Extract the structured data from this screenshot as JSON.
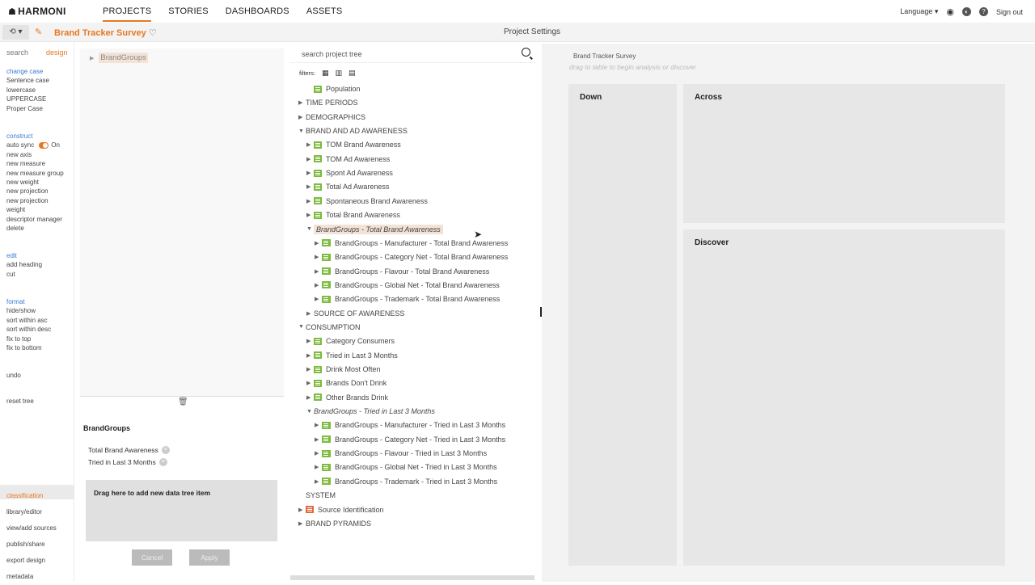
{
  "app": {
    "logo": "HARMONI"
  },
  "nav": {
    "items": [
      "PROJECTS",
      "STORIES",
      "DASHBOARDS",
      "ASSETS"
    ],
    "active": "PROJECTS"
  },
  "topright": {
    "language": "Language",
    "signout": "Sign out"
  },
  "subbar": {
    "project_title": "Brand Tracker Survey",
    "settings": "Project Settings"
  },
  "sidebar": {
    "tabs": [
      "search",
      "design"
    ],
    "active_tab": "design",
    "change_case": {
      "heading": "change case",
      "items": [
        "Sentence case",
        "lowercase",
        "UPPERCASE",
        "Proper Case"
      ]
    },
    "construct": {
      "heading": "construct",
      "auto_sync": "auto sync",
      "auto_sync_state": "On",
      "items": [
        "new axis",
        "new measure",
        "new measure group",
        "new weight",
        "new projection",
        "new projection",
        "weight",
        "descriptor manager",
        "delete"
      ]
    },
    "edit": {
      "heading": "edit",
      "items": [
        "add heading",
        "cut"
      ]
    },
    "format": {
      "heading": "format",
      "items": [
        "hide/show",
        "sort within asc",
        "sort within desc",
        "fix to top",
        "fix to bottom"
      ]
    },
    "undo": "undo",
    "reset": "reset tree",
    "bottom": [
      "classification",
      "library/editor",
      "view/add sources",
      "publish/share",
      "export design",
      "metadata"
    ],
    "bottom_active": "classification"
  },
  "classification": {
    "root_label": "BrandGroups",
    "panel_title": "BrandGroups",
    "items": [
      "Total Brand Awareness",
      "Tried in Last 3 Months"
    ],
    "dropzone": "Drag here to add new data tree item",
    "cancel": "Cancel",
    "apply": "Apply"
  },
  "project_tree": {
    "search_placeholder": "search project tree",
    "filters_label": "filters:",
    "rows": [
      {
        "label": "Population",
        "type": "list",
        "indent": 1,
        "caret": ""
      },
      {
        "label": "TIME PERIODS",
        "type": "folder",
        "indent": 0,
        "caret": "▶"
      },
      {
        "label": "DEMOGRAPHICS",
        "type": "folder",
        "indent": 0,
        "caret": "▶"
      },
      {
        "label": "BRAND AND AD AWARENESS",
        "type": "folder",
        "indent": 0,
        "caret": "▼"
      },
      {
        "label": "TOM Brand Awareness",
        "type": "list",
        "indent": 1,
        "caret": "▶"
      },
      {
        "label": "TOM Ad Awareness",
        "type": "list",
        "indent": 1,
        "caret": "▶"
      },
      {
        "label": "Spont Ad Awareness",
        "type": "list",
        "indent": 1,
        "caret": "▶"
      },
      {
        "label": "Total Ad Awareness",
        "type": "list",
        "indent": 1,
        "caret": "▶"
      },
      {
        "label": "Spontaneous Brand Awareness",
        "type": "list",
        "indent": 1,
        "caret": "▶"
      },
      {
        "label": "Total Brand Awareness",
        "type": "list",
        "indent": 1,
        "caret": "▶"
      },
      {
        "label": "BrandGroups - Total Brand Awareness",
        "type": "hl",
        "indent": 1,
        "caret": "▼"
      },
      {
        "label": "BrandGroups - Manufacturer - Total Brand Awareness",
        "type": "grp",
        "indent": 2,
        "caret": "▶"
      },
      {
        "label": "BrandGroups - Category Net - Total Brand Awareness",
        "type": "grp",
        "indent": 2,
        "caret": "▶"
      },
      {
        "label": "BrandGroups - Flavour - Total Brand Awareness",
        "type": "grp",
        "indent": 2,
        "caret": "▶"
      },
      {
        "label": "BrandGroups - Global Net - Total Brand Awareness",
        "type": "grp",
        "indent": 2,
        "caret": "▶"
      },
      {
        "label": "BrandGroups - Trademark - Total Brand Awareness",
        "type": "grp",
        "indent": 2,
        "caret": "▶"
      },
      {
        "label": "SOURCE OF AWARENESS",
        "type": "folder",
        "indent": 1,
        "caret": "▶"
      },
      {
        "label": "CONSUMPTION",
        "type": "folder",
        "indent": 0,
        "caret": "▼"
      },
      {
        "label": "Category Consumers",
        "type": "list",
        "indent": 1,
        "caret": "▶"
      },
      {
        "label": "Tried in Last 3 Months",
        "type": "list",
        "indent": 1,
        "caret": "▶"
      },
      {
        "label": "Drink Most Often",
        "type": "list",
        "indent": 1,
        "caret": "▶"
      },
      {
        "label": "Brands Don't Drink",
        "type": "list",
        "indent": 1,
        "caret": "▶"
      },
      {
        "label": "Other Brands Drink",
        "type": "list",
        "indent": 1,
        "caret": "▶"
      },
      {
        "label": "BrandGroups - Tried in Last 3 Months",
        "type": "it",
        "indent": 1,
        "caret": "▼"
      },
      {
        "label": "BrandGroups - Manufacturer - Tried in Last 3 Months",
        "type": "grp",
        "indent": 2,
        "caret": "▶"
      },
      {
        "label": "BrandGroups - Category Net - Tried in Last 3 Months",
        "type": "grp",
        "indent": 2,
        "caret": "▶"
      },
      {
        "label": "BrandGroups - Flavour - Tried in Last 3 Months",
        "type": "grp",
        "indent": 2,
        "caret": "▶"
      },
      {
        "label": "BrandGroups - Global Net - Tried in Last 3 Months",
        "type": "grp",
        "indent": 2,
        "caret": "▶"
      },
      {
        "label": "BrandGroups - Trademark - Tried in Last 3 Months",
        "type": "grp",
        "indent": 2,
        "caret": "▶"
      },
      {
        "label": "SYSTEM",
        "type": "folder",
        "indent": 0,
        "caret": ""
      },
      {
        "label": "Source Identification",
        "type": "src",
        "indent": 0,
        "caret": "▶"
      },
      {
        "label": "BRAND PYRAMIDS",
        "type": "folder",
        "indent": 0,
        "caret": "▶"
      }
    ]
  },
  "canvas": {
    "title": "Brand Tracker Survey",
    "hint": "drag to table to begin analysis or discover",
    "down": "Down",
    "across": "Across",
    "discover": "Discover"
  },
  "colors": {
    "accent": "#e87722",
    "variable_green": "#7cbb3d",
    "highlight": "#f3e3d7"
  }
}
